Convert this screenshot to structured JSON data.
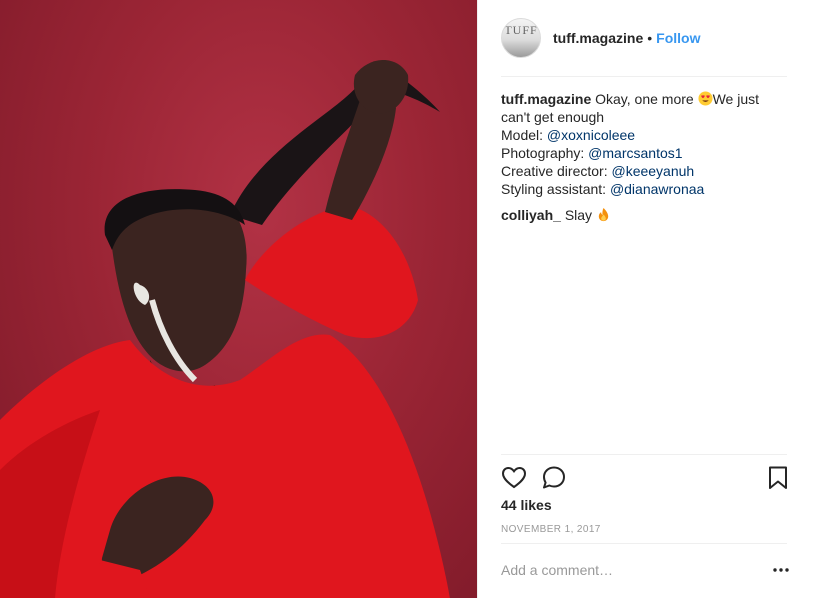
{
  "header": {
    "avatar_text": "TUFF",
    "username": "tuff.magazine",
    "separator": "•",
    "follow_label": "Follow"
  },
  "caption": {
    "username": "tuff.magazine",
    "text_part1": "Okay, one more ",
    "emoji": "heart-eyes-emoji",
    "text_part2": "We just can't get enough",
    "credits": [
      {
        "label": "Model: ",
        "mention": "@xoxnicoleee"
      },
      {
        "label": "Photography: ",
        "mention": "@marcsantos1"
      },
      {
        "label": "Creative director: ",
        "mention": "@keeeyanuh"
      },
      {
        "label": "Styling assistant: ",
        "mention": "@dianawronaa"
      }
    ]
  },
  "comment": {
    "username": "colliyah_",
    "text": "Slay",
    "emoji": "fire-emoji"
  },
  "actions": {
    "icons": [
      "heart-icon",
      "comment-icon",
      "bookmark-icon"
    ]
  },
  "likes": "44 likes",
  "date": "NOVEMBER 1, 2017",
  "add_comment": {
    "placeholder": "Add a comment…",
    "more_icon": "more-options-icon"
  },
  "colors": {
    "link": "#3897f0",
    "mention": "#003569",
    "muted": "#999999",
    "background_photo": "#9b2535",
    "sweater": "#e0161e"
  }
}
